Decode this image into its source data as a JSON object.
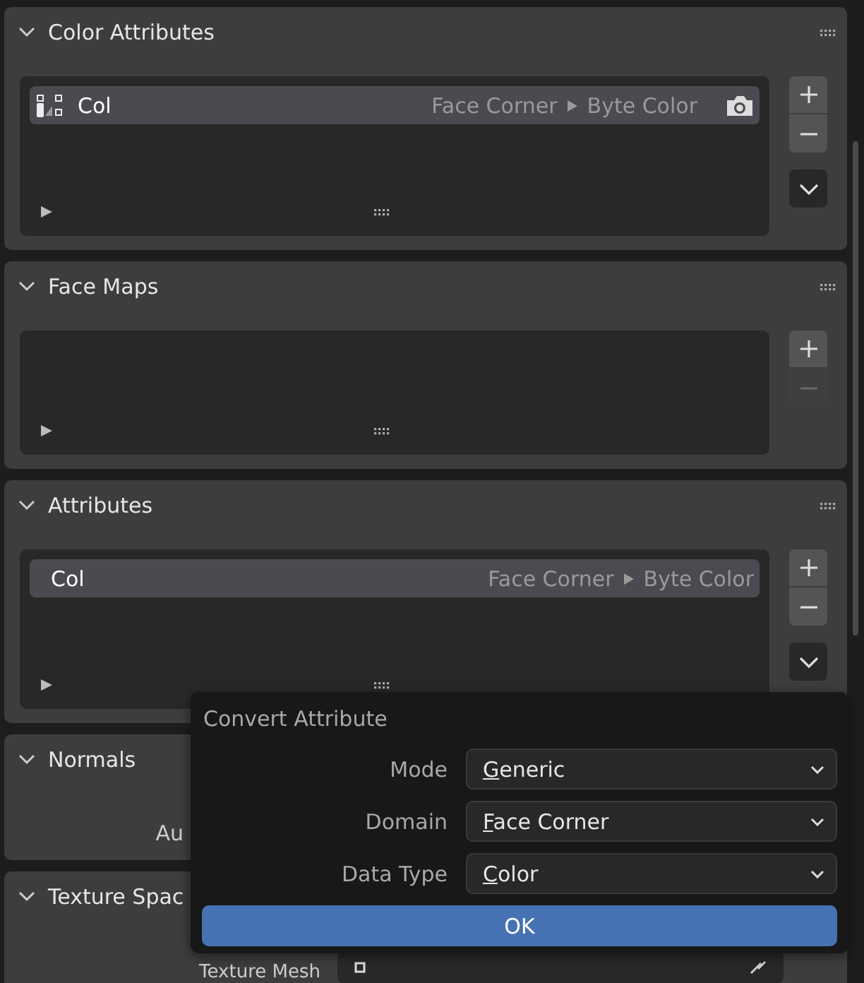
{
  "panels": [
    {
      "title": "Color Attributes",
      "expanded": true,
      "kind": "list",
      "rows": [
        {
          "kind": "color",
          "name": "Col",
          "domain": "Face Corner",
          "data_type": "Byte Color",
          "selected": true
        }
      ],
      "buttons": [
        {
          "kind": "add",
          "disabled": false
        },
        {
          "kind": "remove",
          "disabled": false
        }
      ],
      "menu": true
    },
    {
      "title": "Face Maps",
      "expanded": true,
      "kind": "list",
      "buttons": [
        {
          "kind": "add",
          "disabled": false
        },
        {
          "kind": "remove",
          "disabled": true
        }
      ],
      "menu": false
    },
    {
      "title": "Attributes",
      "expanded": true,
      "kind": "list",
      "rows": [
        {
          "kind": "generic",
          "name": "Col",
          "domain": "Face Corner",
          "data_type": "Byte Color",
          "selected": true
        }
      ],
      "buttons": [
        {
          "kind": "add",
          "disabled": false
        },
        {
          "kind": "remove",
          "disabled": false
        }
      ],
      "menu": true
    },
    {
      "title": "Normals",
      "expanded": true,
      "kind": "props",
      "props": [
        {
          "label": "Au"
        }
      ]
    },
    {
      "title": "Texture Spac",
      "expanded": true,
      "kind": "props",
      "props": [
        {
          "label": "Texture Mesh",
          "field": true
        }
      ]
    }
  ],
  "dialog": {
    "title": "Convert Attribute",
    "fields": [
      {
        "label": "Mode",
        "value": "Generic"
      },
      {
        "label": "Domain",
        "value": "Face Corner"
      },
      {
        "label": "Data Type",
        "value": "Color"
      }
    ],
    "ok": "OK"
  }
}
